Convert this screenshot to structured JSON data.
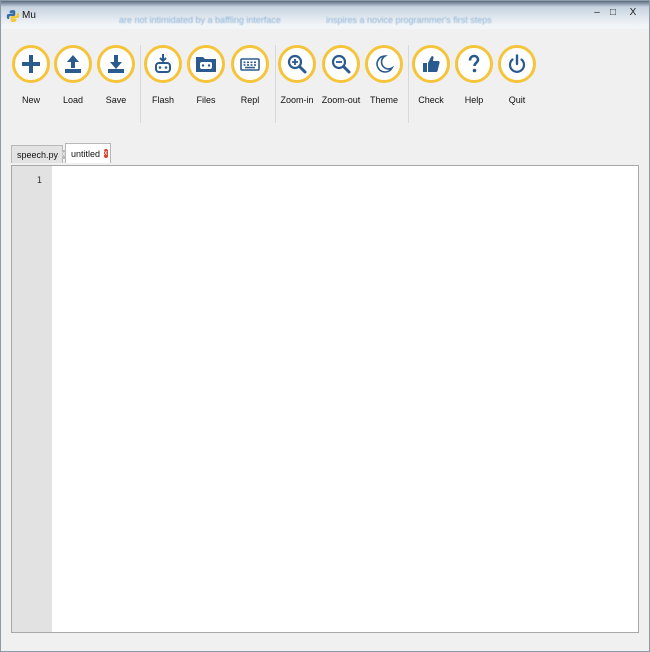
{
  "window": {
    "title": "Mu",
    "blurred_banner_left": "are not intimidated by a baffling interface",
    "blurred_banner_right": "inspires a novice programmer's first steps",
    "minimize_glyph": "–",
    "maximize_glyph": "□",
    "close_glyph": "X"
  },
  "colors": {
    "accent_ring": "#f5c43a",
    "icon_blue": "#2b5b8e",
    "active_tab_close": "#d9432b"
  },
  "toolbar": {
    "buttons": [
      {
        "label": "New",
        "icon": "plus-icon"
      },
      {
        "label": "Load",
        "icon": "upload-icon"
      },
      {
        "label": "Save",
        "icon": "download-icon"
      },
      {
        "label": "Flash",
        "icon": "microbit-flash-icon"
      },
      {
        "label": "Files",
        "icon": "folder-icon"
      },
      {
        "label": "Repl",
        "icon": "keyboard-icon"
      },
      {
        "label": "Zoom-in",
        "icon": "zoom-in-icon"
      },
      {
        "label": "Zoom-out",
        "icon": "zoom-out-icon"
      },
      {
        "label": "Theme",
        "icon": "moon-icon"
      },
      {
        "label": "Check",
        "icon": "thumbs-up-icon"
      },
      {
        "label": "Help",
        "icon": "question-icon"
      },
      {
        "label": "Quit",
        "icon": "power-icon"
      }
    ]
  },
  "tabs": [
    {
      "label": "speech.py",
      "close": "x",
      "active": false
    },
    {
      "label": "untitled",
      "close": "x",
      "active": true
    }
  ],
  "editor": {
    "line_numbers": [
      "1"
    ],
    "content": ""
  }
}
